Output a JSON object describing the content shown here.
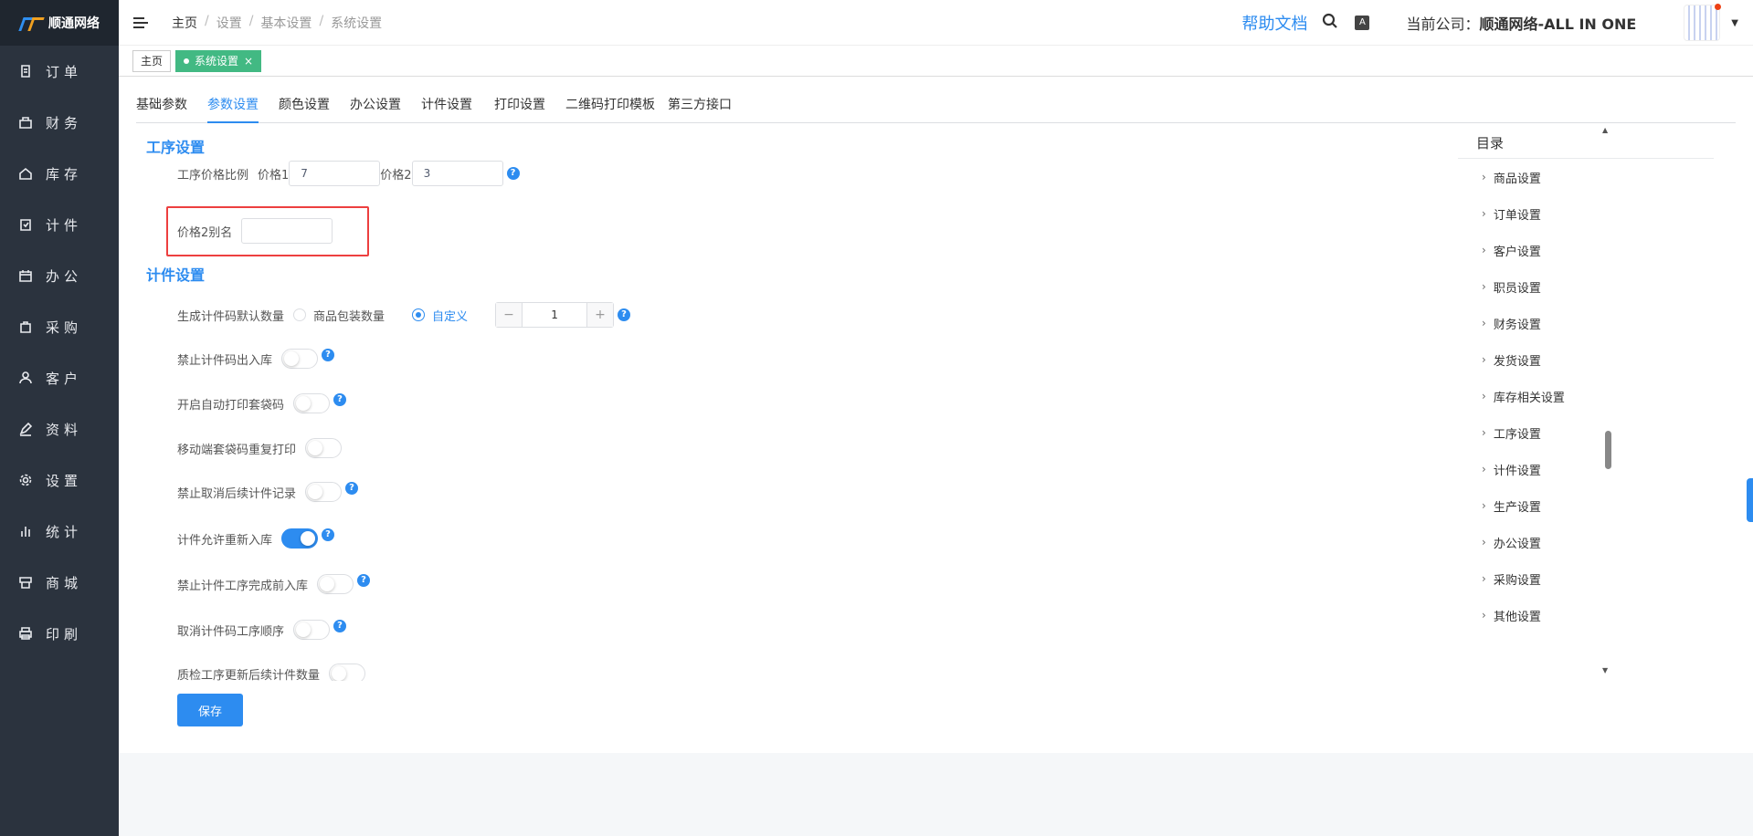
{
  "app": {
    "logo_text": "顺通网络"
  },
  "sidebar": {
    "items": [
      {
        "label": "订单",
        "icon": "order-icon"
      },
      {
        "label": "财务",
        "icon": "wallet-icon"
      },
      {
        "label": "库存",
        "icon": "home-icon"
      },
      {
        "label": "计件",
        "icon": "clipboard-icon"
      },
      {
        "label": "办公",
        "icon": "calendar-icon"
      },
      {
        "label": "采购",
        "icon": "bag-icon"
      },
      {
        "label": "客户",
        "icon": "user-icon"
      },
      {
        "label": "资料",
        "icon": "pen-icon"
      },
      {
        "label": "设置",
        "icon": "gear-icon"
      },
      {
        "label": "统计",
        "icon": "bar-chart-icon"
      },
      {
        "label": "商城",
        "icon": "store-icon"
      },
      {
        "label": "印刷",
        "icon": "printer-icon"
      }
    ]
  },
  "header": {
    "breadcrumb": [
      "主页",
      "基本设置",
      "系统设置"
    ],
    "breadcrumb_lead": "设置",
    "help_label": "帮助文档",
    "lang_label": "A",
    "company_prefix": "当前公司：",
    "company_name": "顺通网络-ALL IN ONE"
  },
  "tagbar": {
    "home_tag": "主页",
    "active_tag": "系统设置",
    "close": "×"
  },
  "tabs": [
    "基础参数",
    "参数设置",
    "颜色设置",
    "办公设置",
    "计件设置",
    "打印设置",
    "二维码打印模板",
    "第三方接口"
  ],
  "active_tab": "参数设置",
  "process_section": {
    "title": "工序设置",
    "price_ratio_label": "工序价格比例",
    "price1_label": "价格1",
    "price1_value": "7",
    "price2_label": "价格2",
    "price2_value": "3",
    "alias_label": "价格2别名",
    "alias_value": ""
  },
  "piece_section": {
    "title": "计件设置",
    "default_qty_label": "生成计件码默认数量",
    "radio_pack": "商品包装数量",
    "radio_custom": "自定义",
    "stepper_value": "1",
    "stepper_minus": "−",
    "stepper_plus": "+",
    "switches": [
      {
        "label": "禁止计件码出入库",
        "on": false,
        "help": true
      },
      {
        "label": "开启自动打印套袋码",
        "on": false,
        "help": true
      },
      {
        "label": "移动端套袋码重复打印",
        "on": false,
        "help": false
      },
      {
        "label": "禁止取消后续计件记录",
        "on": false,
        "help": true
      },
      {
        "label": "计件允许重新入库",
        "on": true,
        "help": true
      },
      {
        "label": "禁止计件工序完成前入库",
        "on": false,
        "help": true
      },
      {
        "label": "取消计件码工序顺序",
        "on": false,
        "help": true
      },
      {
        "label": "质检工序更新后续计件数量",
        "on": false,
        "help": false
      }
    ]
  },
  "save_label": "保存",
  "toc": {
    "title": "目录",
    "items": [
      "商品设置",
      "订单设置",
      "客户设置",
      "职员设置",
      "财务设置",
      "发货设置",
      "库存相关设置",
      "工序设置",
      "计件设置",
      "生产设置",
      "办公设置",
      "采购设置",
      "其他设置"
    ]
  },
  "colors": {
    "accent": "#2d8cf0",
    "sidebar_bg": "#2b333e",
    "active_tag": "#42b983",
    "highlight": "#ed3f3f"
  }
}
